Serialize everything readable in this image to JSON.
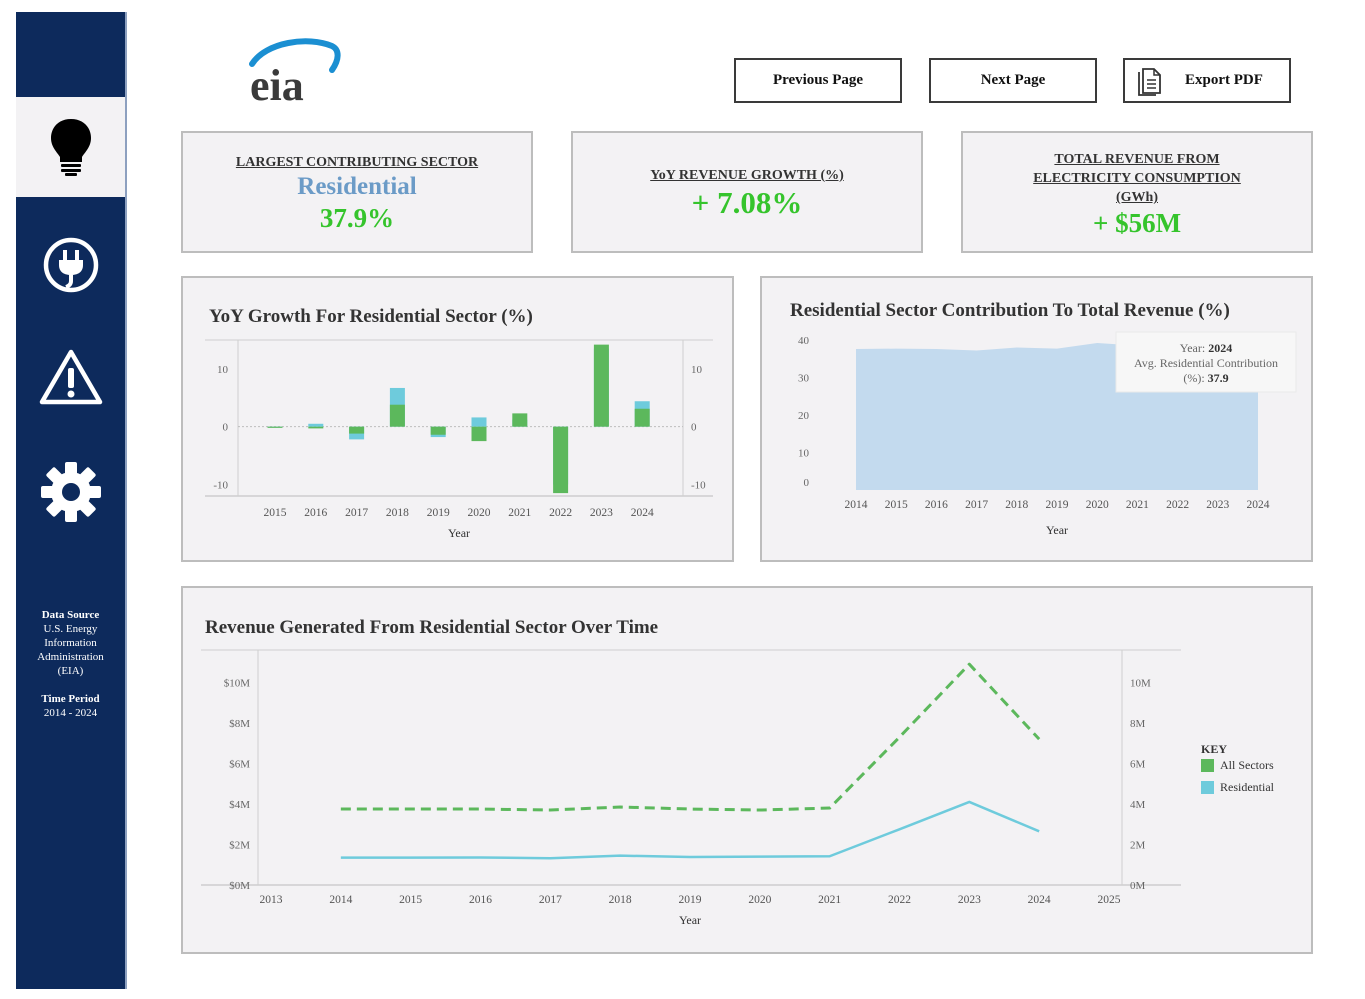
{
  "sidebar": {
    "icons": [
      "lightbulb-icon",
      "plug-icon",
      "warning-icon",
      "gear-icon"
    ],
    "data_source_label": "Data Source",
    "data_source_value": "U.S. Energy Information Administration (EIA)",
    "time_period_label": "Time Period",
    "time_period_value": "2014 - 2024"
  },
  "logo": {
    "text": "eia"
  },
  "buttons": {
    "previous": "Previous Page",
    "next": "Next Page",
    "export": "Export PDF"
  },
  "kpis": {
    "largest_sector": {
      "title": "LARGEST CONTRIBUTING SECTOR",
      "sector": "Residential",
      "value": "37.9%"
    },
    "yoy_growth": {
      "title": "YoY REVENUE GROWTH (%)",
      "value": "+ 7.08%"
    },
    "total_revenue": {
      "title": "TOTAL REVENUE  FROM ELECTRICITY CONSUMPTION (GWh)",
      "value": "+ $56M"
    }
  },
  "colors": {
    "sidebar": "#0d2a5c",
    "green": "#5cb85c",
    "teal": "#6ecbdc",
    "area": "#c3daee",
    "kpi_green": "#35c42c",
    "kpi_blue": "#6b9bc7"
  },
  "chart_data": [
    {
      "type": "bar",
      "title": "YoY Growth For Residential Sector (%)",
      "xlabel": "Year",
      "ylabel": "",
      "categories": [
        "2015",
        "2016",
        "2017",
        "2018",
        "2019",
        "2020",
        "2021",
        "2022",
        "2023",
        "2024"
      ],
      "series": [
        {
          "name": "All Sectors",
          "values": [
            -0.2,
            -0.3,
            -1.2,
            3.8,
            -1.4,
            -2.5,
            2.3,
            -11.5,
            14.2,
            3.1
          ]
        },
        {
          "name": "Residential",
          "values": [
            -0.1,
            0.5,
            -2.2,
            6.7,
            -1.8,
            1.6,
            1.2,
            -10.0,
            13.5,
            4.4
          ]
        }
      ],
      "ylim": [
        -12,
        15
      ],
      "yticks": [
        -10,
        0,
        10
      ]
    },
    {
      "type": "area",
      "title": "Residential Sector Contribution To Total Revenue (%)",
      "xlabel": "Year",
      "ylabel": "",
      "x": [
        "2014",
        "2015",
        "2016",
        "2017",
        "2018",
        "2019",
        "2020",
        "2021",
        "2022",
        "2023",
        "2024"
      ],
      "values": [
        37.6,
        37.7,
        37.6,
        37.2,
        38.0,
        37.7,
        39.2,
        38.5,
        38.0,
        37.9,
        37.9
      ],
      "ylim": [
        0,
        40
      ],
      "yticks": [
        0,
        10,
        20,
        30,
        40
      ],
      "tooltip": {
        "year_label": "Year:",
        "year": "2024",
        "metric_label": "Avg. Residential Contribution (%):",
        "metric_value": "37.9"
      }
    },
    {
      "type": "line",
      "title": "Revenue Generated From Residential Sector Over Time",
      "xlabel": "Year",
      "ylabel": "",
      "x_ticks": [
        "2013",
        "2014",
        "2015",
        "2016",
        "2017",
        "2018",
        "2019",
        "2020",
        "2021",
        "2022",
        "2023",
        "2024",
        "2025"
      ],
      "x": [
        2014,
        2015,
        2016,
        2017,
        2018,
        2019,
        2020,
        2021,
        2022,
        2023,
        2024
      ],
      "series": [
        {
          "name": "All Sectors",
          "values": [
            3.75,
            3.75,
            3.75,
            3.7,
            3.85,
            3.75,
            3.7,
            3.8,
            7.3,
            10.9,
            7.2
          ],
          "style": "dashed"
        },
        {
          "name": "Residential",
          "values": [
            1.35,
            1.35,
            1.36,
            1.32,
            1.45,
            1.38,
            1.4,
            1.42,
            2.75,
            4.1,
            2.65
          ],
          "style": "solid"
        }
      ],
      "left_ticks": [
        "$0M",
        "$2M",
        "$4M",
        "$6M",
        "$8M",
        "$10M"
      ],
      "right_ticks": [
        "0M",
        "2M",
        "4M",
        "6M",
        "8M",
        "10M"
      ],
      "ylim": [
        0,
        11.6
      ],
      "legend_title": "KEY",
      "legend": [
        "All Sectors",
        "Residential"
      ]
    }
  ]
}
